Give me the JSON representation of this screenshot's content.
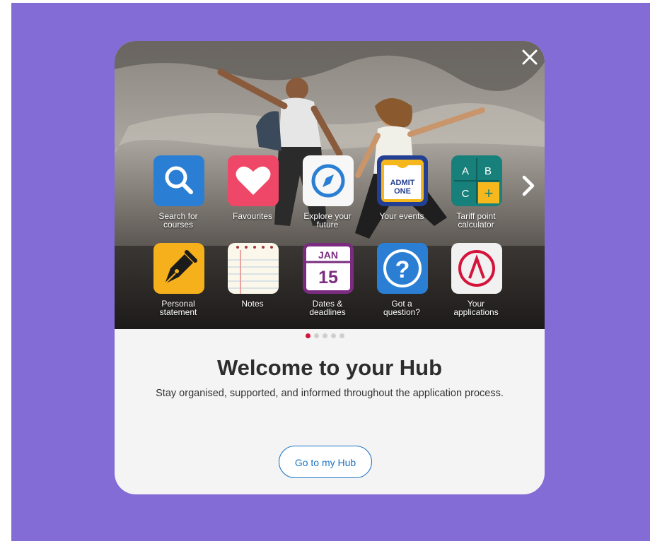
{
  "modal": {
    "title": "Welcome to your Hub",
    "subtitle": "Stay organised, supported, and informed throughout the application process.",
    "cta_label": "Go to my Hub",
    "close_icon": "close-icon",
    "next_icon": "chevron-right-icon"
  },
  "colors": {
    "backdrop": "#836cd6",
    "card": "#f4f4f4",
    "accent": "#1b74c6",
    "active_dot": "#d4143a"
  },
  "apps": [
    {
      "label": "Search for\ncourses",
      "icon": "search-icon"
    },
    {
      "label": "Favourites",
      "icon": "heart-icon"
    },
    {
      "label": "Explore your\nfuture",
      "icon": "compass-icon"
    },
    {
      "label": "Your events",
      "icon": "ticket-icon",
      "icon_text": "ADMIT\nONE"
    },
    {
      "label": "Tariff point\ncalculator",
      "icon": "calculator-icon",
      "icon_text": [
        "A",
        "B",
        "C",
        "+"
      ]
    },
    {
      "label": "Personal\nstatement",
      "icon": "pen-nib-icon"
    },
    {
      "label": "Notes",
      "icon": "notepad-icon"
    },
    {
      "label": "Dates &\ndeadlines",
      "icon": "calendar-icon",
      "icon_text": [
        "JAN",
        "15"
      ]
    },
    {
      "label": "Got a\nquestion?",
      "icon": "question-icon",
      "icon_text": "?"
    },
    {
      "label": "Your\napplications",
      "icon": "applications-icon"
    }
  ],
  "carousel": {
    "page_count": 5,
    "active_page": 1
  }
}
